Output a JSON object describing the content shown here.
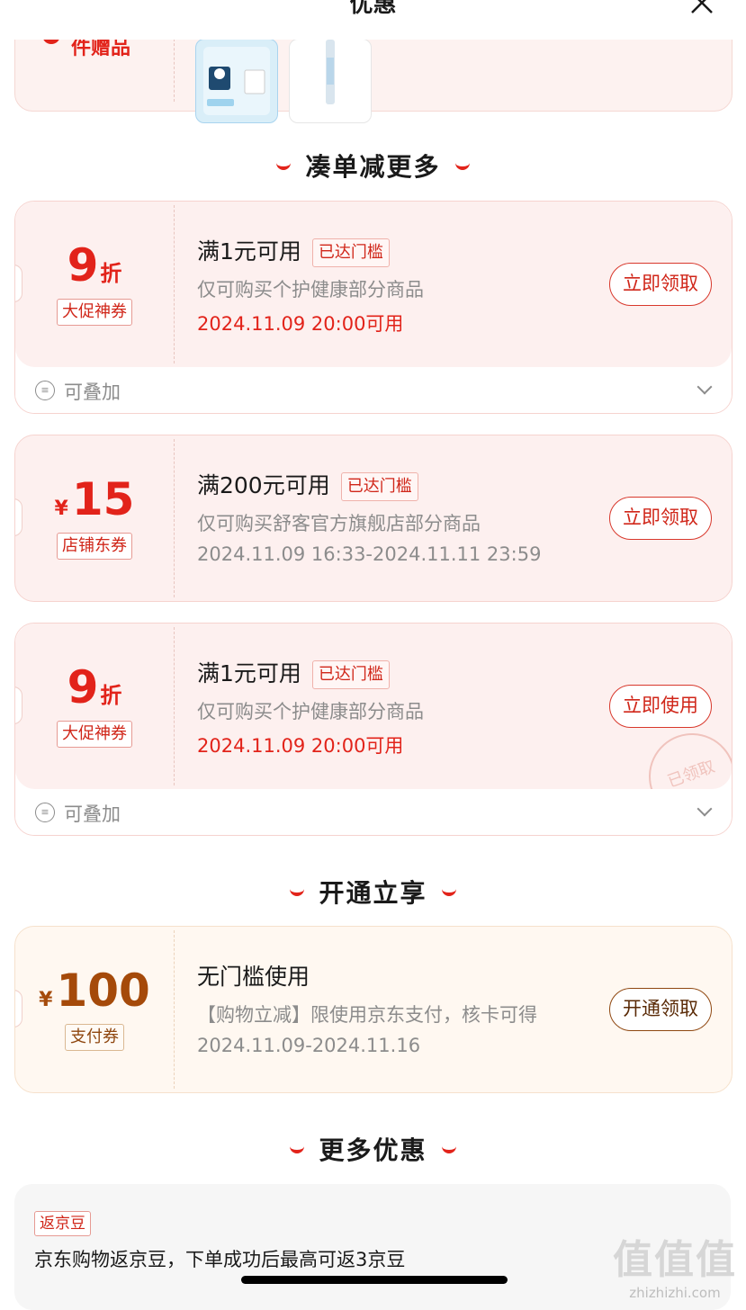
{
  "header": {
    "title": "优惠",
    "close_icon": "close-icon"
  },
  "gift": {
    "label": "件赠品"
  },
  "sections": {
    "collect": "凑单减更多",
    "open": "开通立享",
    "more": "更多优惠"
  },
  "coupons": [
    {
      "value": "9",
      "unit": "折",
      "type_tag": "大促神券",
      "condition": "满1元可用",
      "badge": "已达门槛",
      "desc": "仅可购买个护健康部分商品",
      "time": "2024.11.09 20:00可用",
      "button": "立即领取",
      "stack_label": "可叠加"
    },
    {
      "currency": "¥",
      "value": "15",
      "type_tag": "店铺东券",
      "condition": "满200元可用",
      "badge": "已达门槛",
      "desc": "仅可购买舒客官方旗舰店部分商品",
      "time": "2024.11.09 16:33-2024.11.11 23:59",
      "button": "立即领取"
    },
    {
      "value": "9",
      "unit": "折",
      "type_tag": "大促神券",
      "condition": "满1元可用",
      "badge": "已达门槛",
      "desc": "仅可购买个护健康部分商品",
      "time": "2024.11.09 20:00可用",
      "button": "立即使用",
      "stamp": "已领取",
      "stack_label": "可叠加"
    },
    {
      "currency": "¥",
      "value": "100",
      "type_tag": "支付券",
      "condition": "无门槛使用",
      "desc": "【购物立减】限使用京东支付，核卡可得",
      "time": "2024.11.09-2024.11.16",
      "button": "开通领取"
    }
  ],
  "more": {
    "tag": "返京豆",
    "text": "京东购物返京豆，下单成功后最高可返3京豆"
  },
  "watermark": {
    "big": "值值值",
    "small": "zhizhizhi.com"
  },
  "colors": {
    "accent": "#e2231a",
    "brown": "#a54a0a",
    "muted": "#8c8c8c"
  }
}
